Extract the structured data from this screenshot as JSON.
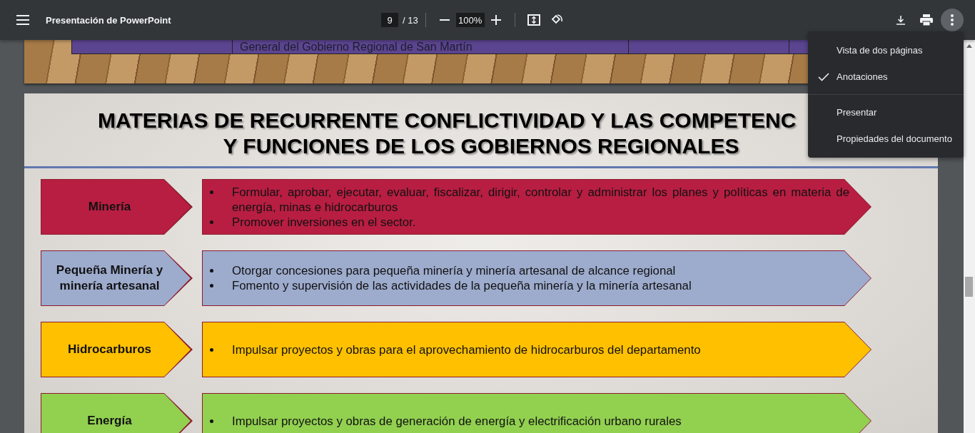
{
  "toolbar": {
    "title": "Presentación de PowerPoint",
    "page": "9",
    "page_total": "/ 13",
    "zoom": "100%"
  },
  "previous_slide": {
    "cell_text": "General del Gobierno Regional de San Martín"
  },
  "slide": {
    "title_line_1": "MATERIAS DE RECURRENTE CONFLICTIVIDAD Y LAS COMPETENC",
    "title_line_2": "Y FUNCIONES DE LOS GOBIERNOS REGIONALES",
    "rows": [
      {
        "category": "Minería",
        "color": "#b81e42",
        "bullets": [
          "Formular, aprobar, ejecutar, evaluar, fiscalizar, dirigir, controlar y administrar los planes y políticas en materia de energía, minas e hidrocarburos",
          "Promover inversiones en el sector."
        ]
      },
      {
        "category": "Pequeña Minería y minería artesanal",
        "color": "#9dabcd",
        "bullets": [
          "Otorgar concesiones para pequeña minería y minería artesanal de alcance regional",
          "Fomento y supervisión de las actividades de la pequeña minería y la minería artesanal"
        ]
      },
      {
        "category": "Hidrocarburos",
        "color": "#ffc000",
        "bullets": [
          "Impulsar proyectos y obras para el aprovechamiento de hidrocarburos del departamento"
        ]
      },
      {
        "category": "Energía",
        "color": "#92d050",
        "bullets": [
          "Impulsar proyectos y obras de generación de energía y electrificación urbano rurales"
        ]
      }
    ]
  },
  "menu": {
    "items": [
      {
        "label": "Vista de dos páginas",
        "checked": false
      },
      {
        "label": "Anotaciones",
        "checked": true
      },
      {
        "label": "Presentar",
        "checked": false
      },
      {
        "label": "Propiedades del documento",
        "checked": false
      }
    ]
  }
}
